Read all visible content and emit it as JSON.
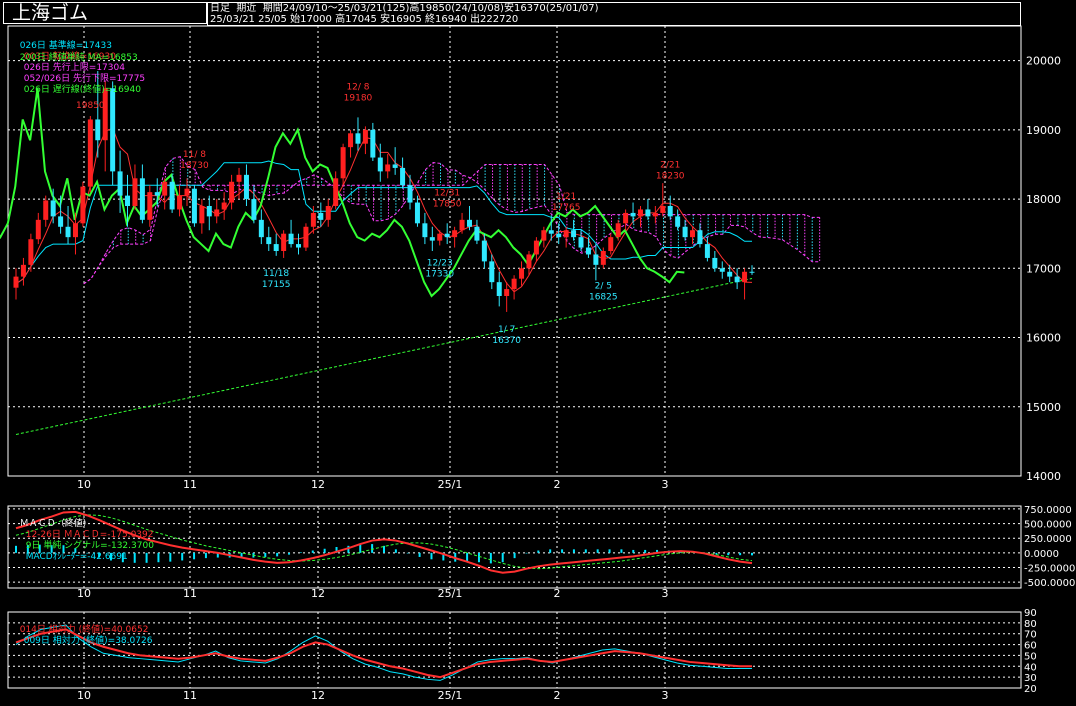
{
  "title": "上海ゴム",
  "info": {
    "line1": "日足  期近  期間24/09/10〜25/03/21(125)高19850(24/10/08)安16370(25/01/07)",
    "line2": "25/03/21 25/05 始17000 高17045 安16905 終16940 出222720"
  },
  "legend": {
    "row1": [
      {
        "text": "026日 基準線=17433",
        "color": "#00e5ff"
      },
      {
        "text": "003日 転換線=16930",
        "color": "#ff3030"
      },
      {
        "text": "026日 先行上限=17304",
        "color": "#ff40ff"
      },
      {
        "text": "052/026日 先行下限=17775",
        "color": "#ff40ff"
      },
      {
        "text": "026日 遅行線(終値)=16940",
        "color": "#33ff33"
      }
    ],
    "row2": [
      {
        "text": "200日 終値単純 MA=16853",
        "color": "#33ff33"
      }
    ]
  },
  "macd_legend": [
    {
      "text": "ＭＡＣＤ（終値）",
      "color": "#ffffff"
    },
    {
      "text": "12-26日 ＭＡＣＤ=-175.0392",
      "color": "#ff3030"
    },
    {
      "text": "9日 単純 シグナル=-132.3700",
      "color": "#33ff33"
    },
    {
      "text": "MACDｵｼﾚｰﾀｰ=-42.6691",
      "color": "#00e5ff"
    }
  ],
  "rsi_legend": [
    {
      "text": "014日 相対力 (終値)=40.0652",
      "color": "#ff3030"
    },
    {
      "text": "009日 相対力 (終値)=38.0726",
      "color": "#00e5ff"
    }
  ],
  "colors": {
    "up": "#ff2020",
    "down": "#30e8ff",
    "grid": "#ffffff",
    "text": "#ffffff"
  },
  "chart_data": [
    {
      "type": "candlestick",
      "panel": "price",
      "ylim": [
        14000,
        20500
      ],
      "yticks": [
        14000,
        15000,
        16000,
        17000,
        18000,
        19000,
        20000
      ],
      "ytick_labels": [
        "14000",
        "15000",
        "16000",
        "17000",
        "18000",
        "19000",
        "20000"
      ],
      "month_labels": [
        "10",
        "11",
        "12",
        "25/1",
        "2",
        "3"
      ],
      "ohlc": [
        [
          16720,
          17000,
          16550,
          16880
        ],
        [
          16880,
          17150,
          16750,
          17050
        ],
        [
          17050,
          17500,
          16950,
          17420
        ],
        [
          17420,
          17800,
          17350,
          17700
        ],
        [
          17700,
          18050,
          17600,
          17980
        ],
        [
          17980,
          18150,
          17650,
          17750
        ],
        [
          17750,
          18050,
          17500,
          17600
        ],
        [
          17600,
          17900,
          17350,
          17450
        ],
        [
          17450,
          17800,
          17200,
          17650
        ],
        [
          17650,
          18250,
          17600,
          18180
        ],
        [
          18180,
          19200,
          18100,
          19150
        ],
        [
          19150,
          19850,
          18600,
          18850
        ],
        [
          18850,
          19700,
          18400,
          19600
        ],
        [
          19600,
          19700,
          18200,
          18400
        ],
        [
          18400,
          18700,
          17800,
          18050
        ],
        [
          18050,
          18350,
          17600,
          17900
        ],
        [
          17900,
          18500,
          17850,
          18300
        ],
        [
          18300,
          18500,
          17650,
          17700
        ],
        [
          17700,
          18200,
          17600,
          18100
        ],
        [
          18100,
          18300,
          17900,
          18050
        ],
        [
          18050,
          18300,
          17850,
          18250
        ],
        [
          18250,
          18350,
          17800,
          17850
        ],
        [
          17850,
          18200,
          17750,
          18050
        ],
        [
          18050,
          18300,
          17900,
          18150
        ],
        [
          18150,
          18200,
          17600,
          17650
        ],
        [
          17650,
          18000,
          17500,
          17900
        ],
        [
          17900,
          18050,
          17550,
          17750
        ],
        [
          17750,
          18000,
          17650,
          17850
        ],
        [
          17850,
          18100,
          17700,
          17950
        ],
        [
          17950,
          18350,
          17850,
          18250
        ],
        [
          18250,
          18450,
          18000,
          18350
        ],
        [
          18350,
          18500,
          17900,
          18000
        ],
        [
          18000,
          18200,
          17650,
          17700
        ],
        [
          17700,
          17850,
          17350,
          17450
        ],
        [
          17450,
          17600,
          17250,
          17350
        ],
        [
          17350,
          17500,
          17180,
          17250
        ],
        [
          17250,
          17550,
          17150,
          17500
        ],
        [
          17500,
          17700,
          17300,
          17350
        ],
        [
          17350,
          17500,
          17200,
          17300
        ],
        [
          17300,
          17650,
          17250,
          17600
        ],
        [
          17600,
          17900,
          17500,
          17800
        ],
        [
          17800,
          17950,
          17600,
          17700
        ],
        [
          17700,
          18000,
          17600,
          17900
        ],
        [
          17900,
          18400,
          17850,
          18300
        ],
        [
          18300,
          18800,
          18200,
          18750
        ],
        [
          18750,
          19000,
          18600,
          18950
        ],
        [
          18950,
          19180,
          18700,
          18800
        ],
        [
          18800,
          19050,
          18650,
          19000
        ],
        [
          19000,
          19100,
          18550,
          18600
        ],
        [
          18600,
          18800,
          18250,
          18400
        ],
        [
          18400,
          18650,
          18300,
          18500
        ],
        [
          18500,
          18750,
          18350,
          18450
        ],
        [
          18450,
          18600,
          18150,
          18200
        ],
        [
          18200,
          18350,
          17850,
          17950
        ],
        [
          17950,
          18050,
          17600,
          17650
        ],
        [
          17650,
          17800,
          17350,
          17450
        ],
        [
          17450,
          17600,
          17250,
          17400
        ],
        [
          17400,
          17550,
          17330,
          17500
        ],
        [
          17500,
          17650,
          17350,
          17450
        ],
        [
          17450,
          17600,
          17300,
          17550
        ],
        [
          17550,
          17800,
          17500,
          17700
        ],
        [
          17700,
          17900,
          17550,
          17600
        ],
        [
          17600,
          17700,
          17350,
          17400
        ],
        [
          17400,
          17500,
          17000,
          17100
        ],
        [
          17100,
          17200,
          16700,
          16800
        ],
        [
          16800,
          16950,
          16450,
          16600
        ],
        [
          16600,
          16800,
          16370,
          16700
        ],
        [
          16700,
          16900,
          16550,
          16850
        ],
        [
          16850,
          17100,
          16750,
          17000
        ],
        [
          17000,
          17250,
          16900,
          17200
        ],
        [
          17200,
          17450,
          17100,
          17400
        ],
        [
          17400,
          17600,
          17300,
          17550
        ],
        [
          17550,
          17765,
          17400,
          17500
        ],
        [
          17500,
          17650,
          17350,
          17450
        ],
        [
          17450,
          17600,
          17300,
          17550
        ],
        [
          17550,
          17700,
          17400,
          17450
        ],
        [
          17450,
          17550,
          17250,
          17300
        ],
        [
          17300,
          17450,
          17150,
          17200
        ],
        [
          17200,
          17350,
          16825,
          17050
        ],
        [
          17050,
          17300,
          17000,
          17250
        ],
        [
          17250,
          17500,
          17200,
          17450
        ],
        [
          17450,
          17700,
          17400,
          17650
        ],
        [
          17650,
          17850,
          17550,
          17800
        ],
        [
          17800,
          17950,
          17650,
          17750
        ],
        [
          17750,
          17900,
          17600,
          17850
        ],
        [
          17850,
          18000,
          17700,
          17750
        ],
        [
          17750,
          17900,
          17650,
          17800
        ],
        [
          17800,
          18230,
          17750,
          17900
        ],
        [
          17900,
          18050,
          17700,
          17750
        ],
        [
          17750,
          17850,
          17550,
          17600
        ],
        [
          17600,
          17700,
          17400,
          17450
        ],
        [
          17450,
          17600,
          17350,
          17550
        ],
        [
          17550,
          17650,
          17300,
          17350
        ],
        [
          17350,
          17450,
          17100,
          17150
        ],
        [
          17150,
          17250,
          16950,
          17000
        ],
        [
          17000,
          17100,
          16850,
          16950
        ],
        [
          16950,
          17050,
          16800,
          16880
        ],
        [
          16880,
          17000,
          16700,
          16800
        ],
        [
          16800,
          17000,
          16550,
          16950
        ],
        [
          16950,
          17045,
          16905,
          16940
        ]
      ],
      "annotations": [
        {
          "label": "19850",
          "date": "10/8",
          "value": 19850,
          "pos": "above"
        },
        {
          "label": "11/ 8",
          "value_label": "18730",
          "pos": "above"
        },
        {
          "label": "12/ 8",
          "value_label": "19180",
          "pos": "above"
        },
        {
          "label": "12/31",
          "value_label": "17850",
          "pos": "above"
        },
        {
          "label": "1/21",
          "value_label": "17765",
          "pos": "above"
        },
        {
          "label": "2/21",
          "value_label": "18230",
          "pos": "above"
        },
        {
          "label": "11/18",
          "value_label": "17155",
          "pos": "below"
        },
        {
          "label": "12/23",
          "value_label": "17330",
          "pos": "below"
        },
        {
          "label": "1/ 7",
          "value_label": "16370",
          "pos": "below"
        },
        {
          "label": "2/ 5",
          "value_label": "16825",
          "pos": "below"
        }
      ]
    },
    {
      "type": "line",
      "panel": "macd",
      "ylim": [
        -600,
        800
      ],
      "yticks": [
        750,
        500,
        250,
        0,
        -250,
        -500
      ],
      "ytick_labels": [
        "750.0000",
        "500.0000",
        "250.0000",
        "0.0000",
        "-250.0000",
        "-500.0000"
      ],
      "series": [
        {
          "name": "MACD",
          "values": [
            420,
            480,
            560,
            620,
            690,
            700,
            640,
            560,
            470,
            380,
            300,
            230,
            180,
            130,
            90,
            60,
            30,
            0,
            -40,
            -80,
            -120,
            -150,
            -170,
            -160,
            -130,
            -90,
            -40,
            20,
            80,
            150,
            210,
            230,
            210,
            160,
            100,
            40,
            -20,
            -90,
            -150,
            -220,
            -300,
            -340,
            -320,
            -270,
            -230,
            -200,
            -180,
            -160,
            -140,
            -120,
            -100,
            -80,
            -60,
            -30,
            0,
            20,
            30,
            20,
            -10,
            -60,
            -110,
            -150,
            -175
          ]
        },
        {
          "name": "シグナル",
          "values": [
            300,
            350,
            420,
            490,
            560,
            620,
            650,
            640,
            600,
            540,
            470,
            400,
            340,
            280,
            220,
            170,
            120,
            80,
            40,
            0,
            -40,
            -80,
            -110,
            -130,
            -140,
            -130,
            -110,
            -80,
            -40,
            10,
            60,
            110,
            150,
            170,
            170,
            150,
            110,
            60,
            0,
            -60,
            -120,
            -180,
            -230,
            -260,
            -270,
            -260,
            -240,
            -220,
            -200,
            -180,
            -160,
            -140,
            -110,
            -80,
            -50,
            -20,
            0,
            10,
            0,
            -30,
            -70,
            -110,
            -132
          ]
        },
        {
          "name": "MACDｵｼﾚｰﾀｰ",
          "values": [
            120,
            130,
            140,
            130,
            130,
            80,
            -10,
            -80,
            -130,
            -160,
            -170,
            -170,
            -160,
            -150,
            -130,
            -110,
            -90,
            -80,
            -80,
            -80,
            -80,
            -70,
            -60,
            -30,
            10,
            40,
            70,
            100,
            120,
            140,
            150,
            120,
            60,
            -10,
            -70,
            -110,
            -130,
            -150,
            -150,
            -160,
            -180,
            -160,
            -90,
            -10,
            40,
            60,
            60,
            60,
            60,
            60,
            60,
            60,
            50,
            50,
            50,
            40,
            30,
            10,
            -10,
            -30,
            -40,
            -40,
            -43
          ]
        }
      ]
    },
    {
      "type": "line",
      "panel": "rsi",
      "ylim": [
        20,
        90
      ],
      "yticks": [
        90,
        80,
        70,
        60,
        50,
        40,
        30,
        20
      ],
      "ytick_labels": [
        "90",
        "80",
        "70",
        "60",
        "50",
        "40",
        "30",
        "20"
      ],
      "series": [
        {
          "name": "014日 相対力",
          "values": [
            62,
            66,
            70,
            72,
            74,
            68,
            62,
            58,
            55,
            52,
            50,
            49,
            48,
            47,
            48,
            50,
            52,
            49,
            47,
            46,
            45,
            48,
            52,
            58,
            62,
            60,
            55,
            50,
            46,
            43,
            40,
            38,
            35,
            32,
            30,
            34,
            38,
            42,
            44,
            45,
            46,
            47,
            45,
            44,
            46,
            48,
            50,
            52,
            54,
            53,
            52,
            50,
            48,
            46,
            44,
            43,
            42,
            41,
            40,
            40
          ]
        },
        {
          "name": "009日 相対力",
          "values": [
            60,
            68,
            74,
            76,
            78,
            66,
            58,
            52,
            50,
            48,
            47,
            46,
            45,
            44,
            47,
            50,
            54,
            48,
            45,
            44,
            43,
            47,
            54,
            62,
            68,
            63,
            54,
            47,
            42,
            39,
            35,
            33,
            30,
            28,
            27,
            32,
            38,
            44,
            46,
            47,
            47,
            48,
            45,
            43,
            46,
            49,
            52,
            55,
            56,
            54,
            52,
            49,
            46,
            43,
            41,
            40,
            39,
            38,
            38,
            38
          ]
        }
      ]
    }
  ]
}
